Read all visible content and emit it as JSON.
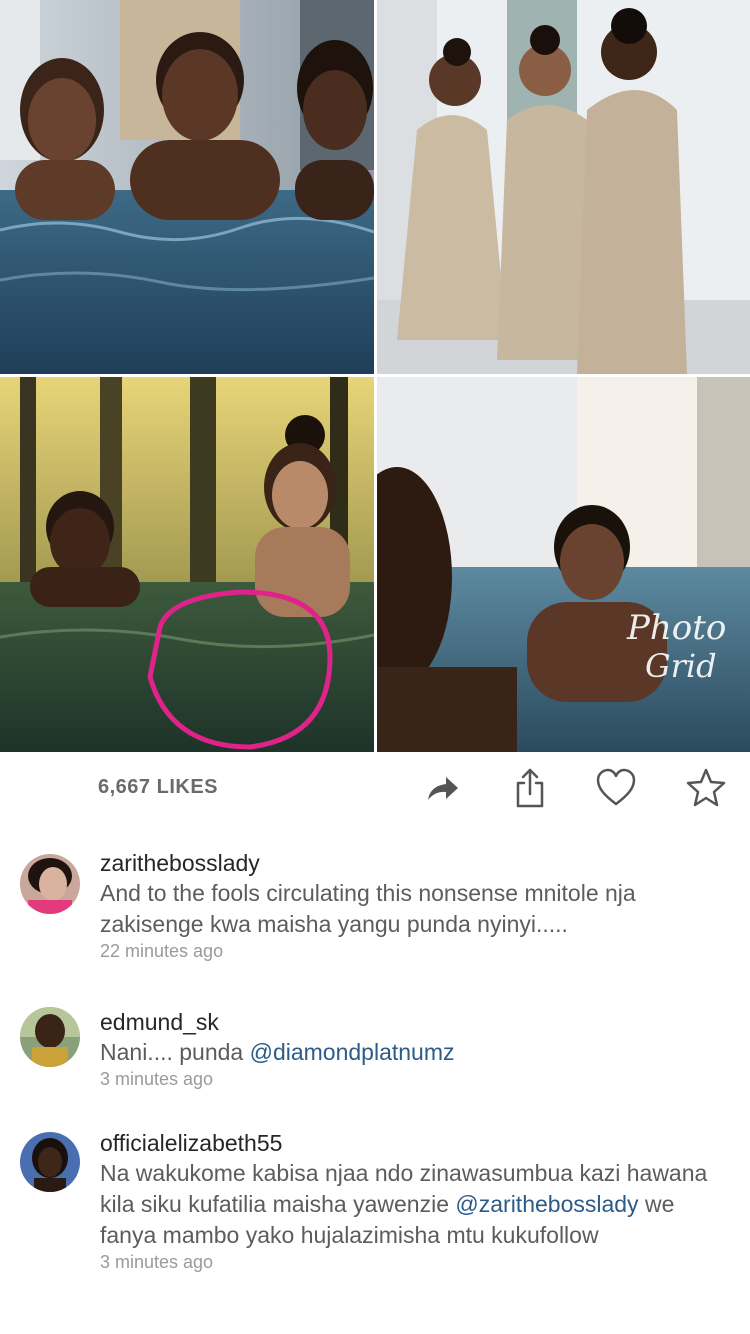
{
  "post": {
    "collage_label": "Photo Grid",
    "likes": "6,667 LIKES"
  },
  "actions": [
    {
      "icon": "share-arrow-icon"
    },
    {
      "icon": "upload-icon"
    },
    {
      "icon": "heart-icon"
    },
    {
      "icon": "star-icon"
    }
  ],
  "comments": [
    {
      "username": "zarithebosslady",
      "text": "And to the fools circulating this nonsense mnitole nja zakisenge kwa maisha yangu punda nyinyi.....",
      "time": "22 minutes ago"
    },
    {
      "username": "edmund_sk",
      "text": "Nani.... punda ",
      "mention": "@diamondplatnumz",
      "time": "3 minutes ago"
    },
    {
      "username": "officialelizabeth55",
      "text_part1": "Na wakukome kabisa njaa ndo zinawasumbua kazi hawana kila siku kufatilia maisha yawenzie ",
      "mention": "@zarithebosslady",
      "text_part2": "  we fanya mambo yako hujalazimisha mtu kukufollow",
      "time": "3 minutes ago"
    }
  ],
  "colors": {
    "link": "#2d5b87",
    "muted": "#9a9a9a",
    "text": "#262626"
  }
}
